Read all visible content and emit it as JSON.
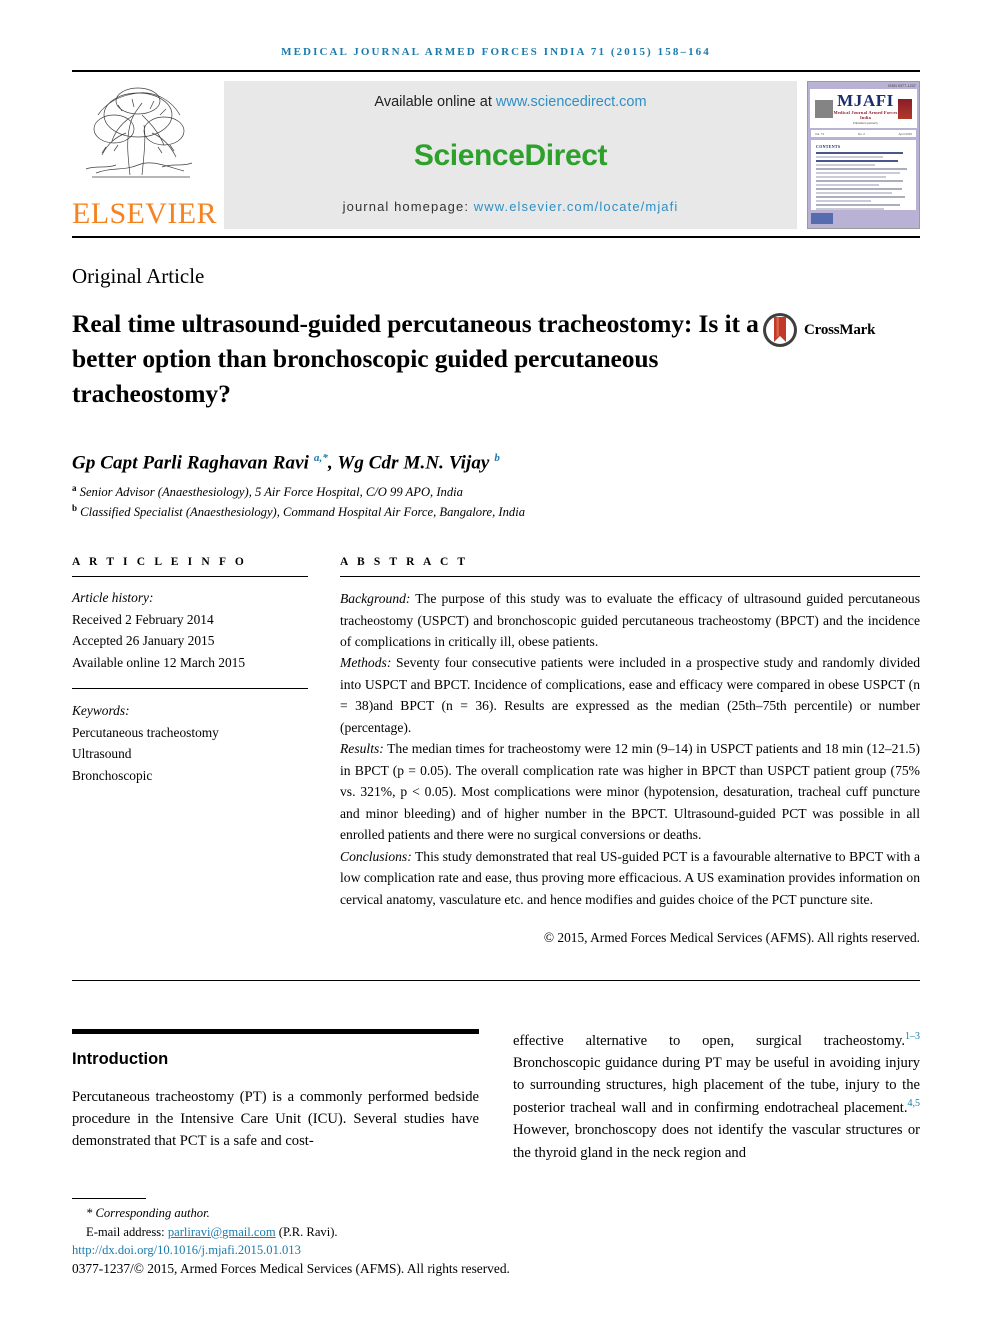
{
  "running_head": "MEDICAL JOURNAL ARMED FORCES INDIA 71 (2015) 158–164",
  "masthead": {
    "publisher": "ELSEVIER",
    "available_prefix": "Available online at ",
    "available_url": "www.sciencedirect.com",
    "sciencedirect_logo": "ScienceDirect",
    "homepage_prefix": "journal homepage: ",
    "homepage_url": "www.elsevier.com/locate/mjafi",
    "cover": {
      "issn": "ISSN 0377-1237",
      "title": "MJAFI",
      "subtitle": "Medical Journal Armed Forces India",
      "tagline": "Published quarterly",
      "bar_left": "Vol. 71",
      "bar_center": "No. 2",
      "bar_right": "April 2015",
      "contents_label": "CONTENTS"
    }
  },
  "article_type": "Original Article",
  "title": "Real time ultrasound-guided percutaneous tracheostomy: Is it a better option than bronchoscopic guided percutaneous tracheostomy?",
  "crossmark_label": "CrossMark",
  "authors_html": "Gp Capt Parli Raghavan Ravi <sup>a,*</sup>, Wg Cdr M.N. Vijay <sup>b</sup>",
  "affiliations": [
    {
      "marker": "a",
      "text": "Senior Advisor (Anaesthesiology), 5 Air Force Hospital, C/O 99 APO, India"
    },
    {
      "marker": "b",
      "text": "Classified Specialist (Anaesthesiology), Command Hospital Air Force, Bangalore, India"
    }
  ],
  "article_info": {
    "label": "A R T I C L E   I N F O",
    "history_label": "Article history:",
    "history": [
      "Received 2 February 2014",
      "Accepted 26 January 2015",
      "Available online 12 March 2015"
    ],
    "keywords_label": "Keywords:",
    "keywords": [
      "Percutaneous tracheostomy",
      "Ultrasound",
      "Bronchoscopic"
    ]
  },
  "abstract": {
    "label": "A B S T R A C T",
    "sections": [
      {
        "heading": "Background:",
        "text": " The purpose of this study was to evaluate the efficacy of ultrasound guided percutaneous tracheostomy (USPCT) and bronchoscopic guided percutaneous tracheostomy (BPCT) and the incidence of complications in critically ill, obese patients."
      },
      {
        "heading": "Methods:",
        "text": " Seventy four consecutive patients were included in a prospective study and randomly divided into USPCT and BPCT. Incidence of complications, ease and efficacy were compared in obese USPCT (n = 38)and BPCT (n = 36). Results are expressed as the median (25th–75th percentile) or number (percentage)."
      },
      {
        "heading": "Results:",
        "text": " The median times for tracheostomy were 12 min (9–14) in USPCT patients and 18 min (12–21.5) in BPCT (p = 0.05). The overall complication rate was higher in BPCT than USPCT patient group (75% vs. 321%, p < 0.05). Most complications were minor (hypotension, desaturation, tracheal cuff puncture and minor bleeding) and of higher number in the BPCT. Ultrasound-guided PCT was possible in all enrolled patients and there were no surgical conversions or deaths."
      },
      {
        "heading": "Conclusions:",
        "text": " This study demonstrated that real US-guided PCT is a favourable alternative to BPCT with a low complication rate and ease, thus proving more efficacious. A US examination provides information on cervical anatomy, vasculature etc. and hence modifies and guides choice of the PCT puncture site."
      }
    ],
    "copyright": "© 2015, Armed Forces Medical Services (AFMS). All rights reserved."
  },
  "introduction": {
    "title": "Introduction",
    "col1": "Percutaneous tracheostomy (PT) is a commonly performed bedside procedure in the Intensive Care Unit (ICU). Several studies have demonstrated that PCT is a safe and cost-",
    "col2_a": "effective alternative to open, surgical tracheostomy.",
    "col2_ref1": "1–3",
    "col2_b": " Bronchoscopic guidance during PT may be useful in avoiding injury to surrounding structures, high placement of the tube, injury to the posterior tracheal wall and in confirming endotracheal placement.",
    "col2_ref2": "4,5",
    "col2_c": " However, bronchoscopy does not identify the vascular structures or the thyroid gland in the neck region and"
  },
  "footer": {
    "corresponding": "* Corresponding author.",
    "email_label": "E-mail address: ",
    "email": "parliravi@gmail.com",
    "email_suffix": " (P.R. Ravi).",
    "doi": "http://dx.doi.org/10.1016/j.mjafi.2015.01.013",
    "issn_line": "0377-1237/© 2015, Armed Forces Medical Services (AFMS). All rights reserved."
  },
  "colors": {
    "link_blue": "#1a7bad",
    "sciencedirect_green": "#2ea02c",
    "elsevier_orange": "#F5821F",
    "cover_purple": "#b9b2d4",
    "crossmark_red": "#c0392b"
  }
}
